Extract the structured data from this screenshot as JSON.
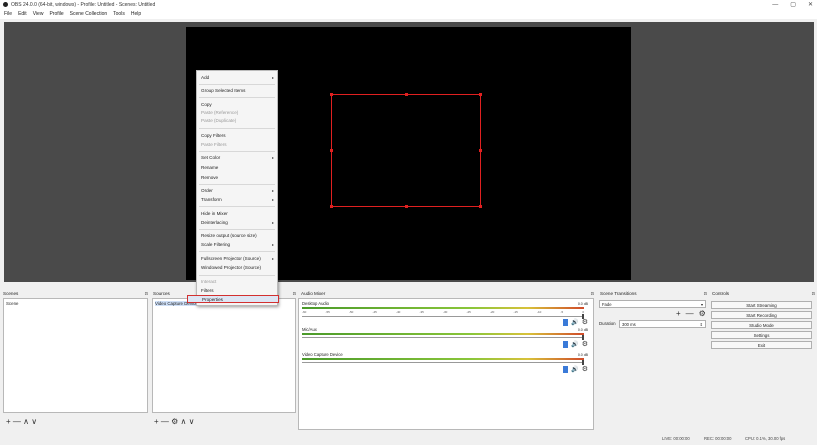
{
  "window": {
    "title": "OBS 24.0.0 (64-bit, windows) - Profile: Untitled - Scenes: Untitled",
    "minimize": "—",
    "maximize": "▢",
    "close": "✕"
  },
  "menubar": [
    "File",
    "Edit",
    "View",
    "Profile",
    "Scene Collection",
    "Tools",
    "Help"
  ],
  "context_menu": {
    "items": [
      {
        "label": "Add",
        "submenu": true
      },
      {
        "label": "Group Selected Items"
      },
      {
        "label": "Copy"
      },
      {
        "label": "Paste (Reference)",
        "disabled": true
      },
      {
        "label": "Paste (Duplicate)",
        "disabled": true
      },
      {
        "label": "Copy Filters"
      },
      {
        "label": "Paste Filters",
        "disabled": true
      },
      {
        "label": "Set Color",
        "submenu": true
      },
      {
        "label": "Rename"
      },
      {
        "label": "Remove"
      },
      {
        "label": "Order",
        "submenu": true
      },
      {
        "label": "Transform",
        "submenu": true
      },
      {
        "label": "Hide in Mixer"
      },
      {
        "label": "Deinterlacing",
        "submenu": true
      },
      {
        "label": "Resize output (source size)"
      },
      {
        "label": "Scale Filtering",
        "submenu": true
      },
      {
        "label": "Fullscreen Projector (Source)",
        "submenu": true
      },
      {
        "label": "Windowed Projector (Source)"
      },
      {
        "label": "Interact",
        "disabled": true
      },
      {
        "label": "Filters"
      },
      {
        "label": "Properties",
        "highlighted": true
      }
    ],
    "arrow": "▸"
  },
  "docks": {
    "scenes": {
      "title": "Scenes",
      "items": [
        "Scene"
      ]
    },
    "sources": {
      "title": "Sources",
      "items": [
        "Video Capture Device"
      ]
    },
    "mixer": {
      "title": "Audio Mixer",
      "tracks": [
        {
          "name": "Desktop Audio",
          "db": "0.0 dB"
        },
        {
          "name": "Mic/Aux",
          "db": "0.0 dB"
        },
        {
          "name": "Video Capture Device",
          "db": "0.0 dB"
        }
      ],
      "ticks": [
        "-60",
        "-55",
        "-50",
        "-45",
        "-40",
        "-35",
        "-30",
        "-25",
        "-20",
        "-15",
        "-10",
        "-5",
        "0"
      ]
    },
    "transitions": {
      "title": "Scene Transitions",
      "transition": "Fade",
      "duration_label": "Duration",
      "duration_value": "300 ms",
      "plus": "+",
      "minus": "—",
      "gear": "⚙"
    },
    "controls": {
      "title": "Controls",
      "buttons": [
        "Start Streaming",
        "Start Recording",
        "Studio Mode",
        "Settings",
        "Exit"
      ]
    },
    "float_icon": "⊡",
    "scenes_toolbar": "+ — ∧ ∨",
    "sources_toolbar": "+ — ⚙ ∧ ∨"
  },
  "status": {
    "live": "LIVE: 00:00:00",
    "rec": "REC: 00:00:00",
    "cpu": "CPU: 0.1%, 30.00 fps"
  },
  "colors": {
    "selection": "#e02020",
    "menu_highlight_border": "#d23030"
  }
}
